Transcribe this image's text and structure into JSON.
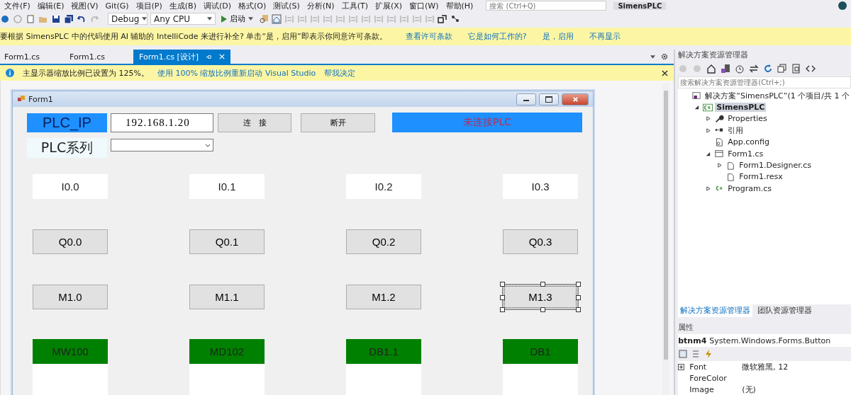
{
  "menu_bar": [
    "文件(F)",
    "编辑(E)",
    "视图(V)",
    "Git(G)",
    "项目(P)",
    "生成(B)",
    "调试(D)",
    "格式(O)",
    "测试(S)",
    "分析(N)",
    "工具(T)",
    "扩展(X)",
    "窗口(W)",
    "帮助(H)"
  ],
  "title_bar": {
    "search_placeholder": "搜索 (Ctrl+Q)",
    "solution_name": "SimensPLC"
  },
  "toolbar": {
    "configuration": "Debug",
    "platform": "Any CPU",
    "start_label": "启动"
  },
  "intellicode_bar": {
    "message": "要根据 SimensPLC 中的代码使用 AI 辅助的 IntelliCode 来进行补全? 单击“是，启用”即表示你同意许可条款。",
    "links": [
      "查看许可条款",
      "它是如何工作的?",
      "是，启用",
      "不再显示"
    ]
  },
  "document_tabs": [
    {
      "label": "Form1.cs",
      "selected": false
    },
    {
      "label": "Form1.cs",
      "selected": false
    },
    {
      "label": "Form1.cs [设计]",
      "selected": true
    }
  ],
  "scaling_bar": {
    "message": "主显示器缩放比例已设置为 125%。",
    "links": [
      "使用 100% 缩放比例重新启动 Visual Studio",
      "帮我决定"
    ]
  },
  "form": {
    "title": "Form1",
    "ip_label": "PLC_IP",
    "ip_value": "192.168.1.20",
    "connect_button": "连　接",
    "disconnect_button": "断开",
    "status": "未连接PLC",
    "series_label": "PLC系列",
    "rows": [
      {
        "kind": "label",
        "cells": [
          {
            "text": "I0.0",
            "selected": false
          },
          {
            "text": "I0.1",
            "selected": false
          },
          {
            "text": "I0.2",
            "selected": false
          },
          {
            "text": "I0.3",
            "selected": false
          }
        ]
      },
      {
        "kind": "button",
        "cells": [
          {
            "text": "Q0.0",
            "selected": false
          },
          {
            "text": "Q0.1",
            "selected": false
          },
          {
            "text": "Q0.2",
            "selected": false
          },
          {
            "text": "Q0.3",
            "selected": false
          }
        ]
      },
      {
        "kind": "button",
        "cells": [
          {
            "text": "M1.0",
            "selected": false
          },
          {
            "text": "M1.1",
            "selected": false
          },
          {
            "text": "M1.2",
            "selected": false
          },
          {
            "text": "M1.3",
            "selected": true
          }
        ]
      },
      {
        "kind": "data",
        "cells": [
          {
            "text": "MW100",
            "selected": false
          },
          {
            "text": "MD102",
            "selected": false
          },
          {
            "text": "DB1.1",
            "selected": false
          },
          {
            "text": "DB1",
            "selected": false
          }
        ]
      }
    ]
  },
  "solution_explorer": {
    "title": "解决方案资源管理器",
    "search_placeholder": "搜索解决方案资源管理器(Ctrl+;)",
    "tree": [
      {
        "kind": "solution",
        "label": "解决方案“SimensPLC”(1 个项目/共 1 个",
        "expandable": false,
        "selected": false,
        "children": [
          {
            "kind": "project",
            "label": "SimensPLC",
            "expandable": true,
            "expanded": true,
            "selected": true,
            "children": [
              {
                "kind": "properties",
                "label": "Properties",
                "expandable": true,
                "expanded": false,
                "selected": false
              },
              {
                "kind": "references",
                "label": "引用",
                "expandable": true,
                "expanded": false,
                "selected": false
              },
              {
                "kind": "config",
                "label": "App.config",
                "expandable": false,
                "selected": false
              },
              {
                "kind": "form",
                "label": "Form1.cs",
                "expandable": true,
                "expanded": true,
                "selected": false,
                "children": [
                  {
                    "kind": "file",
                    "label": "Form1.Designer.cs",
                    "expandable": true,
                    "expanded": false,
                    "selected": false
                  },
                  {
                    "kind": "file",
                    "label": "Form1.resx",
                    "expandable": false,
                    "selected": false
                  }
                ]
              },
              {
                "kind": "code",
                "label": "Program.cs",
                "expandable": true,
                "expanded": false,
                "selected": false
              }
            ]
          }
        ]
      }
    ],
    "tabs": [
      {
        "label": "解决方案资源管理器",
        "selected": true
      },
      {
        "label": "团队资源管理器",
        "selected": false
      }
    ]
  },
  "properties": {
    "title": "属性",
    "object_name": "btnm4",
    "object_type": "System.Windows.Forms.Button",
    "rows": [
      {
        "name": "Font",
        "value": "微软雅黑, 12",
        "expandable": true
      },
      {
        "name": "ForeColor",
        "expandable": false
      },
      {
        "name": "Image",
        "value": "(无)",
        "expandable": false
      }
    ]
  }
}
